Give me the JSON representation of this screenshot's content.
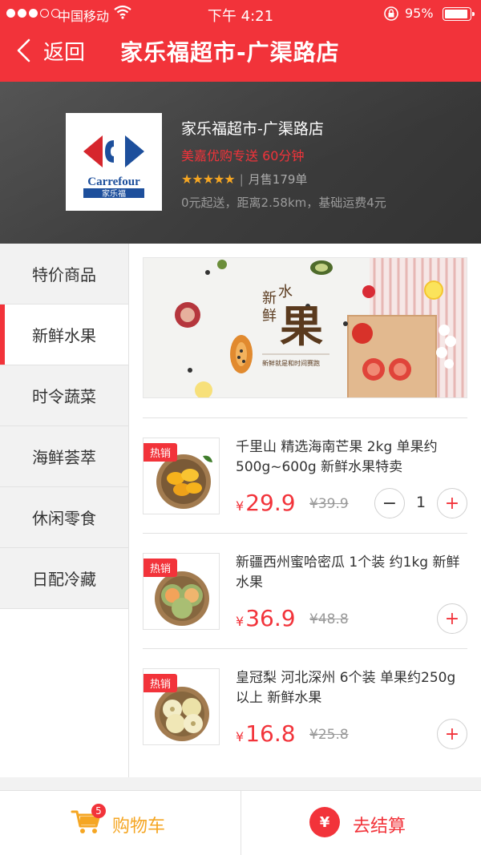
{
  "status_bar": {
    "carrier": "中国移动",
    "time": "下午 4:21",
    "battery": "95%",
    "battery_level": 0.95
  },
  "nav": {
    "back_label": "返回",
    "title": "家乐福超市-广渠路店"
  },
  "store": {
    "logo_text": "Carrefour",
    "logo_subtext": "家乐福",
    "name": "家乐福超市-广渠路店",
    "delivery": "美嘉优购专送 60分钟",
    "stars": "★★★★★",
    "rating_value": 5,
    "monthly_sales": "月售179单",
    "fees": "0元起送，距离2.58km，基础运费4元"
  },
  "categories": [
    {
      "label": "特价商品",
      "active": false
    },
    {
      "label": "新鲜水果",
      "active": true
    },
    {
      "label": "时令蔬菜",
      "active": false
    },
    {
      "label": "海鲜荟萃",
      "active": false
    },
    {
      "label": "休闲零食",
      "active": false
    },
    {
      "label": "日配冷藏",
      "active": false
    }
  ],
  "banner": {
    "heading_small_1": "新",
    "heading_small_2": "鲜",
    "heading_small_3": "水",
    "heading_big": "果",
    "tagline": "新鲜就是和时间赛跑"
  },
  "products": [
    {
      "badge": "热销",
      "name": "千里山 精选海南芒果 2kg 单果约500g~600g 新鲜水果特卖",
      "currency": "¥",
      "price": "29.9",
      "old_price": "¥39.9",
      "quantity": "1",
      "image": "mango"
    },
    {
      "badge": "热销",
      "name": "新疆西州蜜哈密瓜 1个装 约1kg 新鲜水果",
      "currency": "¥",
      "price": "36.9",
      "old_price": "¥48.8",
      "image": "melon"
    },
    {
      "badge": "热销",
      "name": "皇冠梨 河北深州 6个装 单果约250g以上 新鲜水果",
      "currency": "¥",
      "price": "16.8",
      "old_price": "¥25.8",
      "image": "pear"
    }
  ],
  "bottom_bar": {
    "cart_label": "购物车",
    "cart_count": "5",
    "checkout_label": "去结算",
    "checkout_icon": "¥"
  },
  "colors": {
    "accent": "#f2333a",
    "cart": "#f5a623"
  },
  "icons": {
    "back": "chevron-left-icon",
    "wifi": "wifi-icon",
    "lock": "rotation-lock-icon",
    "plus": "plus-icon",
    "minus": "minus-icon",
    "cart": "cart-icon",
    "checkout": "wallet-icon"
  }
}
